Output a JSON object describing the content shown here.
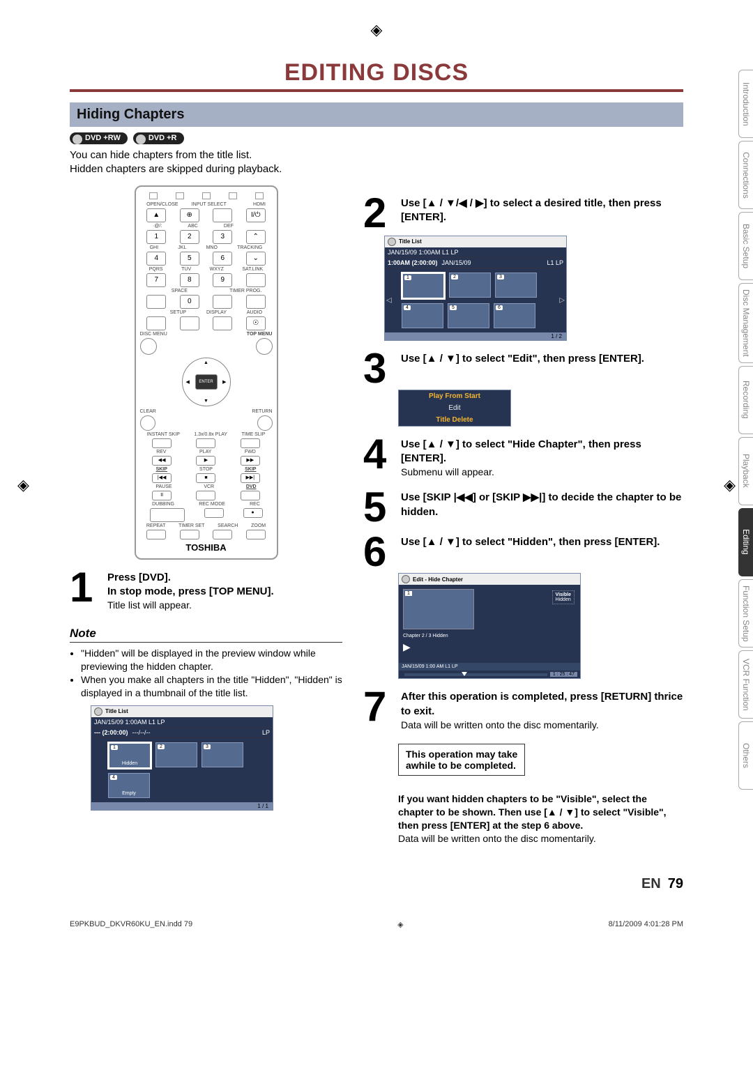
{
  "title": "EDITING DISCS",
  "section": "Hiding Chapters",
  "badges": [
    "DVD +RW",
    "DVD +R"
  ],
  "intro": "You can hide chapters from the title list.\nHidden chapters are skipped during playback.",
  "remote": {
    "brand": "TOSHIBA",
    "row1_labels": [
      "OPEN/CLOSE",
      "INPUT SELECT",
      "",
      "HDMI"
    ],
    "numpad_labels": [
      [
        "·@/:",
        "ABC",
        "DEF",
        ""
      ],
      [
        "GHI",
        "JKL",
        "MNO",
        "TRACKING"
      ],
      [
        "PQRS",
        "TUV",
        "WXYZ",
        "SAT.LINK"
      ],
      [
        "",
        "SPACE",
        "",
        "TIMER PROG."
      ],
      [
        "",
        "SETUP",
        "DISPLAY",
        "AUDIO"
      ]
    ],
    "disc_menu": "DISC MENU",
    "top_menu": "TOP MENU",
    "enter": "ENTER",
    "clear": "CLEAR",
    "ret": "RETURN",
    "transport_labels": [
      "INSTANT SKIP",
      "1.3x/0.8x PLAY",
      "TIME SLIP"
    ],
    "rev": "REV",
    "play": "PLAY",
    "fwd": "FWD",
    "skip": "SKIP",
    "stop": "STOP",
    "pause": "PAUSE",
    "vcr": "VCR",
    "dvd": "DVD",
    "dub": "DUBBING",
    "recmode": "REC MODE",
    "rec": "REC",
    "bottom": [
      "REPEAT",
      "TIMER SET",
      "SEARCH",
      "ZOOM"
    ]
  },
  "steps": {
    "1": {
      "bold": "Press [DVD].\nIn stop mode, press [TOP MENU].",
      "sub": "Title list will appear."
    },
    "2": {
      "bold": "Use [▲ / ▼/◀ / ▶] to select a desired title, then press [ENTER]."
    },
    "3": {
      "bold": "Use [▲ / ▼] to select \"Edit\", then press [ENTER]."
    },
    "4": {
      "bold": "Use [▲ / ▼] to select \"Hide Chapter\", then press [ENTER].",
      "sub": "Submenu will appear."
    },
    "5": {
      "bold": "Use [SKIP |◀◀] or [SKIP ▶▶|] to decide the chapter to be hidden."
    },
    "6": {
      "bold": "Use [▲ / ▼] to select \"Hidden\", then press [ENTER]."
    },
    "7": {
      "bold": "After this operation is completed, press [RETURN] thrice to exit.",
      "sub": "Data will be written onto the disc momentarily."
    }
  },
  "note": {
    "head": "Note",
    "items": [
      "\"Hidden\" will be displayed in the preview window while previewing the hidden chapter.",
      "When you make all chapters in the title \"Hidden\", \"Hidden\" is displayed in a thumbnail of the title list."
    ]
  },
  "osd_note": {
    "title": "Title List",
    "line1": "JAN/15/09 1:00AM L1 LP",
    "line2_left": "--- (2:00:00)",
    "line2_mid": "---/--/--",
    "line2_right": "LP",
    "thumbs": [
      "1",
      "2",
      "3",
      "4"
    ],
    "tags": {
      "1": "Hidden",
      "4": "Empty"
    },
    "page": "1 / 1"
  },
  "osd_step2": {
    "title": "Title List",
    "line1": "JAN/15/09 1:00AM   L1   LP",
    "line2_left": "1:00AM (2:00:00)",
    "line2_mid": "JAN/15/09",
    "line2_right": "L1   LP",
    "thumbs": [
      "1",
      "2",
      "3",
      "4",
      "5",
      "6"
    ],
    "page": "1 / 2"
  },
  "menu": {
    "items": [
      "Play From Start",
      "Edit",
      "Title Delete"
    ],
    "highlight": 0
  },
  "edit_osd": {
    "title": "Edit - Hide Chapter",
    "thumb_num": "1",
    "opt1": "Visible",
    "opt2": "Hidden",
    "chapline": "Chapter    2 / 3    Hidden",
    "footer": "JAN/15/09 1:00 AM L1   LP",
    "time": "1 : 25 : 47"
  },
  "warn": "This operation may take\nawhile to be completed.",
  "final_bold": "If you want hidden chapters to be \"Visible\", select the chapter to be shown. Then use [▲ / ▼] to select \"Visible\", then press [ENTER] at the step 6 above.",
  "final_sub": "Data will be written onto the disc momentarily.",
  "side_tabs": [
    "Introduction",
    "Connections",
    "Basic Setup",
    "Disc Management",
    "Recording",
    "Playback",
    "Editing",
    "Function Setup",
    "VCR Function",
    "Others"
  ],
  "side_active_index": 6,
  "foot_lang": "EN",
  "foot_page": "79",
  "print_left": "E9PKBUD_DKVR60KU_EN.indd   79",
  "print_right": "8/11/2009   4:01:28 PM"
}
